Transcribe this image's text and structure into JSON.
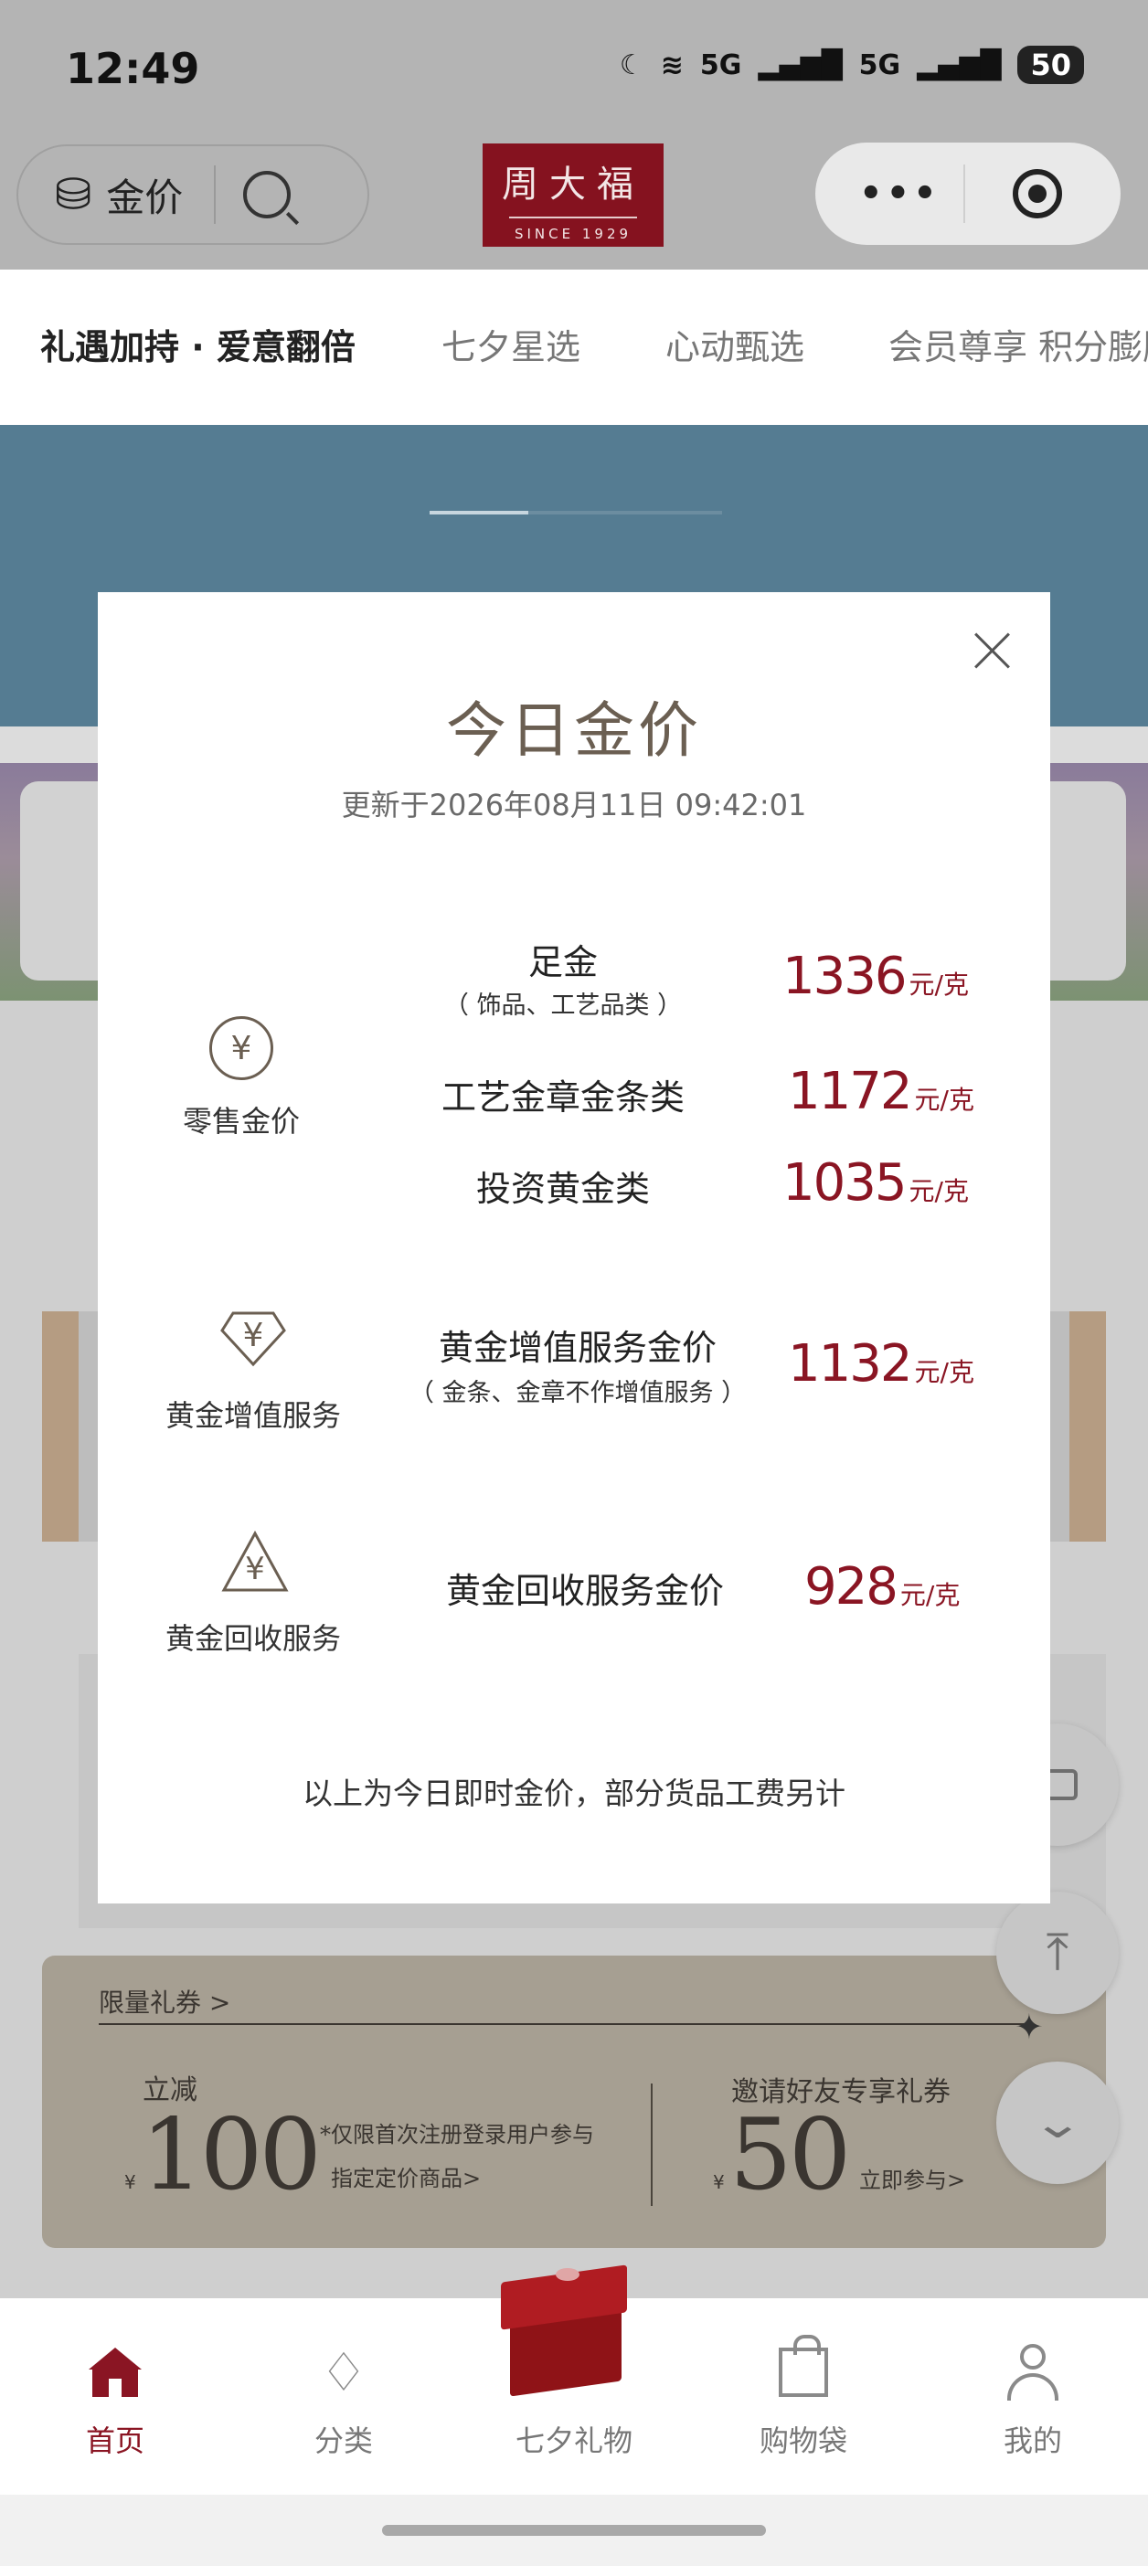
{
  "status_bar": {
    "time": "12:49",
    "network1": "5G",
    "network2": "5G",
    "battery": "50"
  },
  "header": {
    "gold_price_label": "金价",
    "logo_text": "周大福",
    "logo_since": "SINCE 1929"
  },
  "tabs": [
    "礼遇加持 · 爱意翻倍",
    "七夕星选",
    "心动甄选",
    "会员尊享 积分膨胀"
  ],
  "coupon": {
    "title": "限量礼券 >",
    "left_label": "立减",
    "currency": "¥",
    "left_amount": "100",
    "left_note": "*仅限首次注册登录用户参与",
    "left_link": "指定定价商品>",
    "right_label": "邀请好友专享礼券",
    "right_amount": "50",
    "right_link": "立即参与>"
  },
  "nav": [
    {
      "label": "首页",
      "icon": "home-icon",
      "active": true
    },
    {
      "label": "分类",
      "icon": "diamond-icon"
    },
    {
      "label": "七夕礼物",
      "icon": "gift-box-icon"
    },
    {
      "label": "购物袋",
      "icon": "bag-icon"
    },
    {
      "label": "我的",
      "icon": "user-icon"
    }
  ],
  "modal": {
    "title": "今日金价",
    "updated": "更新于2026年08月11日 09:42:01",
    "unit": "元/克",
    "retail": {
      "label": "零售金价",
      "items": [
        {
          "name": "足金",
          "sub": "（ 饰品、工艺品类 ）",
          "price": "1336"
        },
        {
          "name": "工艺金章金条类",
          "price": "1172"
        },
        {
          "name": "投资黄金类",
          "price": "1035"
        }
      ]
    },
    "value_added": {
      "label": "黄金增值服务",
      "name": "黄金增值服务金价",
      "sub": "（ 金条、金章不作增值服务 ）",
      "price": "1132"
    },
    "recycle": {
      "label": "黄金回收服务",
      "name": "黄金回收服务金价",
      "price": "928"
    },
    "footnote": "以上为今日即时金价，部分货品工费另计"
  },
  "colors": {
    "brand_red": "#8a1523",
    "gold_brown": "#6b5f52"
  }
}
